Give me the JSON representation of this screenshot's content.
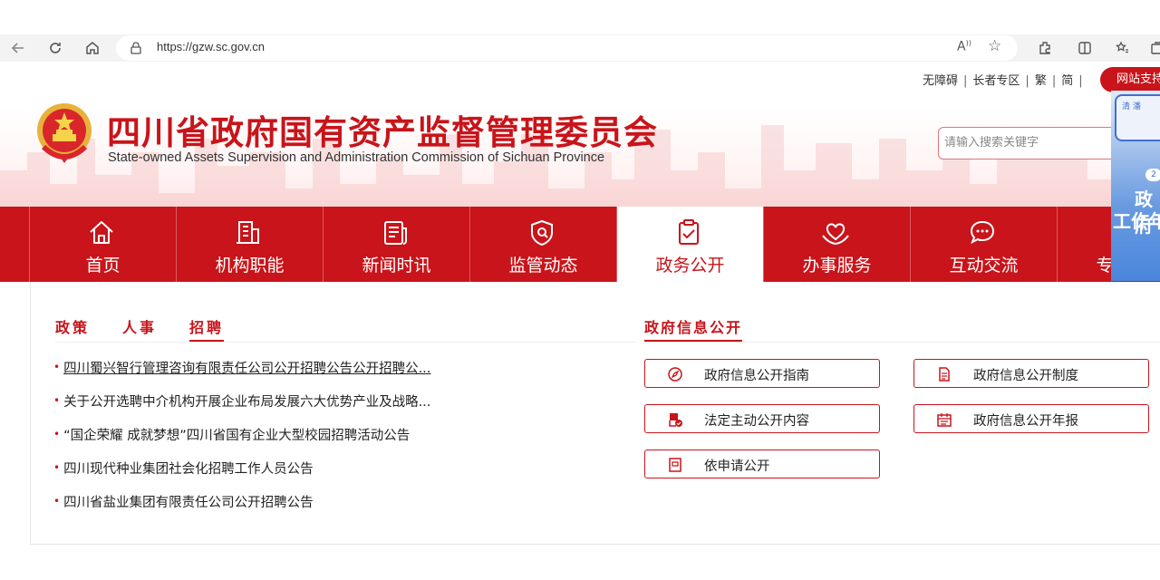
{
  "browser": {
    "url": "https://gzw.sc.gov.cn"
  },
  "header": {
    "title_cn": "四川省政府国有资产监督管理委员会",
    "title_en": "State-owned Assets Supervision and Administration Commission of Sichuan Province",
    "top_links": [
      "无障碍",
      "长者专区",
      "繁",
      "简"
    ],
    "site_support": "网站支持",
    "search_placeholder": "请输入搜索关键字"
  },
  "side_banner": {
    "line1": "政府",
    "line2": "工作年",
    "badge": "2"
  },
  "nav": {
    "items": [
      {
        "label": "首页",
        "icon": "home-icon"
      },
      {
        "label": "机构职能",
        "icon": "building-icon"
      },
      {
        "label": "新闻时讯",
        "icon": "news-icon"
      },
      {
        "label": "监管动态",
        "icon": "shield-icon"
      },
      {
        "label": "政务公开",
        "icon": "clipboard-check-icon",
        "active": true
      },
      {
        "label": "办事服务",
        "icon": "heart-hands-icon"
      },
      {
        "label": "互动交流",
        "icon": "chat-icon"
      },
      {
        "label": "专题专栏",
        "icon": "topic-icon"
      }
    ]
  },
  "tabs": [
    "政策",
    "人事",
    "招聘"
  ],
  "active_tab": "招聘",
  "news": [
    "四川蜀兴智行管理咨询有限责任公司公开招聘公告公开招聘公...",
    "关于公开选聘中介机构开展企业布局发展六大优势产业及战略...",
    "“国企荣耀 成就梦想”四川省国有企业大型校园招聘活动公告",
    "四川现代种业集团社会化招聘工作人员公告",
    "四川省盐业集团有限责任公司公开招聘公告"
  ],
  "gov_info": {
    "title": "政府信息公开",
    "buttons": [
      {
        "label": "政府信息公开指南",
        "icon": "compass-icon"
      },
      {
        "label": "政府信息公开制度",
        "icon": "document-icon"
      },
      {
        "label": "法定主动公开内容",
        "icon": "file-check-icon"
      },
      {
        "label": "政府信息公开年报",
        "icon": "calendar-icon"
      },
      {
        "label": "依申请公开",
        "icon": "form-icon"
      }
    ]
  },
  "colors": {
    "primary": "#c8141a",
    "nav_divider": "#e05a5e"
  }
}
